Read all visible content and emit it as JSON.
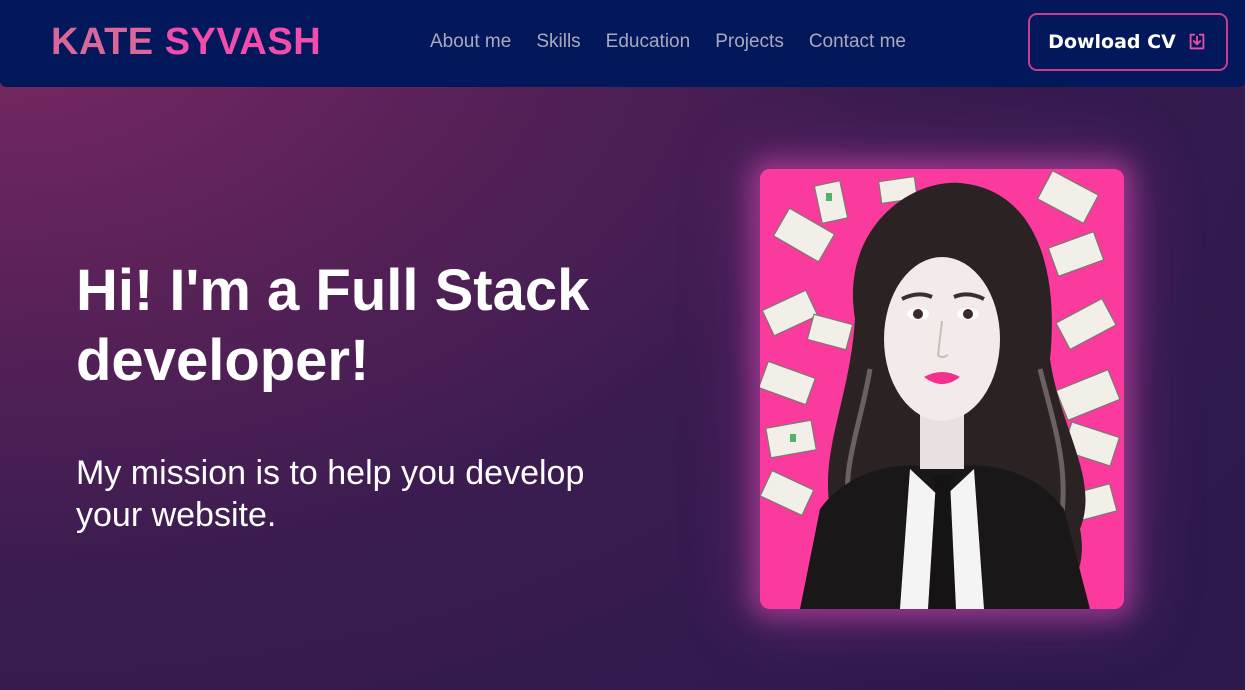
{
  "header": {
    "logo_first": "KATE",
    "logo_last": "SYVASH",
    "nav": [
      {
        "label": "About me"
      },
      {
        "label": "Skills"
      },
      {
        "label": "Education"
      },
      {
        "label": "Projects"
      },
      {
        "label": "Contact me"
      }
    ],
    "cv_button": "Dowload CV",
    "cv_icon": "download-icon"
  },
  "hero": {
    "headline": "Hi! I'm a Full Stack developer!",
    "mission": "My mission is to help you develop your website.",
    "portrait_alt": "Illustrated portrait with floating banknotes on pink background"
  },
  "colors": {
    "navbar_bg": "#03185a",
    "logo_first": "#d9679a",
    "logo_last": "#f24dad",
    "accent": "#c83c8e",
    "portrait_bg": "#fb3a9d"
  }
}
